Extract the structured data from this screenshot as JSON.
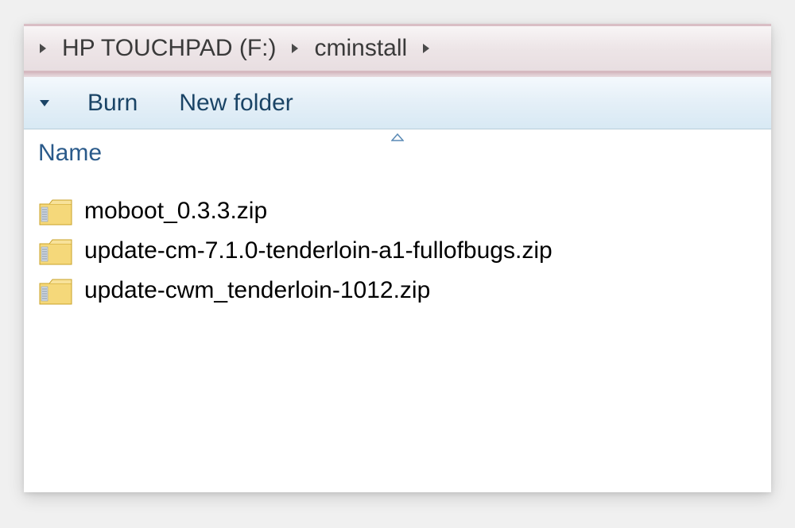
{
  "breadcrumb": {
    "items": [
      {
        "label": "HP TOUCHPAD (F:)"
      },
      {
        "label": "cminstall"
      }
    ]
  },
  "toolbar": {
    "burn_label": "Burn",
    "new_folder_label": "New folder"
  },
  "column_header": {
    "name_label": "Name"
  },
  "files": [
    {
      "name": "moboot_0.3.3.zip"
    },
    {
      "name": "update-cm-7.1.0-tenderloin-a1-fullofbugs.zip"
    },
    {
      "name": "update-cwm_tenderloin-1012.zip"
    }
  ],
  "icons": {
    "right_arrow": "▶",
    "dropdown_arrow": "▼",
    "sort_asc": "▲"
  }
}
